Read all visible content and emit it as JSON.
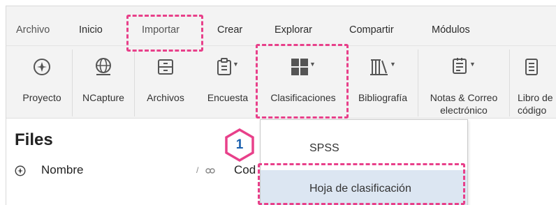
{
  "ribbon": {
    "tabs": [
      {
        "label": "Archivo"
      },
      {
        "label": "Inicio"
      },
      {
        "label": "Importar"
      },
      {
        "label": "Crear"
      },
      {
        "label": "Explorar"
      },
      {
        "label": "Compartir"
      },
      {
        "label": "Módulos"
      }
    ],
    "buttons": [
      {
        "label": "Proyecto",
        "icon": "project-icon"
      },
      {
        "label": "NCapture",
        "icon": "globe-icon"
      },
      {
        "label": "Archivos",
        "icon": "files-icon"
      },
      {
        "label": "Encuesta",
        "icon": "survey-icon"
      },
      {
        "label": "Clasificaciones",
        "icon": "classifications-icon"
      },
      {
        "label": "Bibliografía",
        "icon": "bibliography-icon"
      },
      {
        "label": "Notas & Correo",
        "label2": "electrónico",
        "icon": "notes-email-icon"
      },
      {
        "label": "Libro de",
        "label2": "código",
        "icon": "codebook-icon"
      }
    ]
  },
  "files": {
    "title": "Files",
    "columns": {
      "name": "Nombre",
      "sort_indicator": "/",
      "code": "Cod"
    }
  },
  "dropdown": {
    "items": [
      {
        "label": "SPSS"
      },
      {
        "label": "Hoja de clasificación"
      }
    ]
  },
  "callout": {
    "number": "1"
  },
  "colors": {
    "ribbon_bg": "#f3f3f3",
    "highlight": "#e8408a",
    "badge_text": "#1a5fae",
    "menu_hover": "#dce6f2"
  }
}
